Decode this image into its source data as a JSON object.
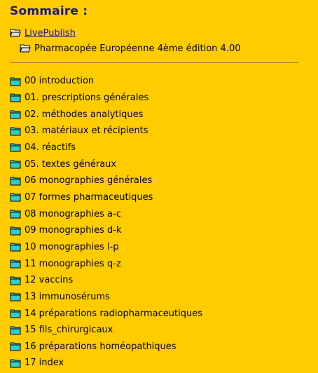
{
  "sommaire": {
    "title": "Sommaire :",
    "root_label": "LivePublish",
    "sub_label": "Pharmacopée Européenne 4ème édition 4.00",
    "items": [
      {
        "label": "00 introduction"
      },
      {
        "label": "01. prescriptions générales"
      },
      {
        "label": "02. méthodes analytiques"
      },
      {
        "label": "03. matériaux et récipients"
      },
      {
        "label": "04. réactifs"
      },
      {
        "label": "05. textes généraux"
      },
      {
        "label": "06 monographies générales"
      },
      {
        "label": "07 formes pharmaceutiques"
      },
      {
        "label": "08 monographies a-c"
      },
      {
        "label": "09 monographies d-k"
      },
      {
        "label": "10 monographies l-p"
      },
      {
        "label": "11 monographies q-z"
      },
      {
        "label": "12 vaccins"
      },
      {
        "label": "13 immunosérums"
      },
      {
        "label": "14 préparations radiopharmaceutiques"
      },
      {
        "label": "15 fils_chirurgicaux"
      },
      {
        "label": "16 préparations homéopathiques"
      },
      {
        "label": "17 index"
      }
    ]
  },
  "icons": {
    "open_folder": "open-folder-icon",
    "closed_folder": "folder-icon"
  },
  "colors": {
    "background": "#FFCC00",
    "title": "#1a1a8c",
    "link": "#1a1a8c",
    "folder_fill": "#33cccc"
  }
}
